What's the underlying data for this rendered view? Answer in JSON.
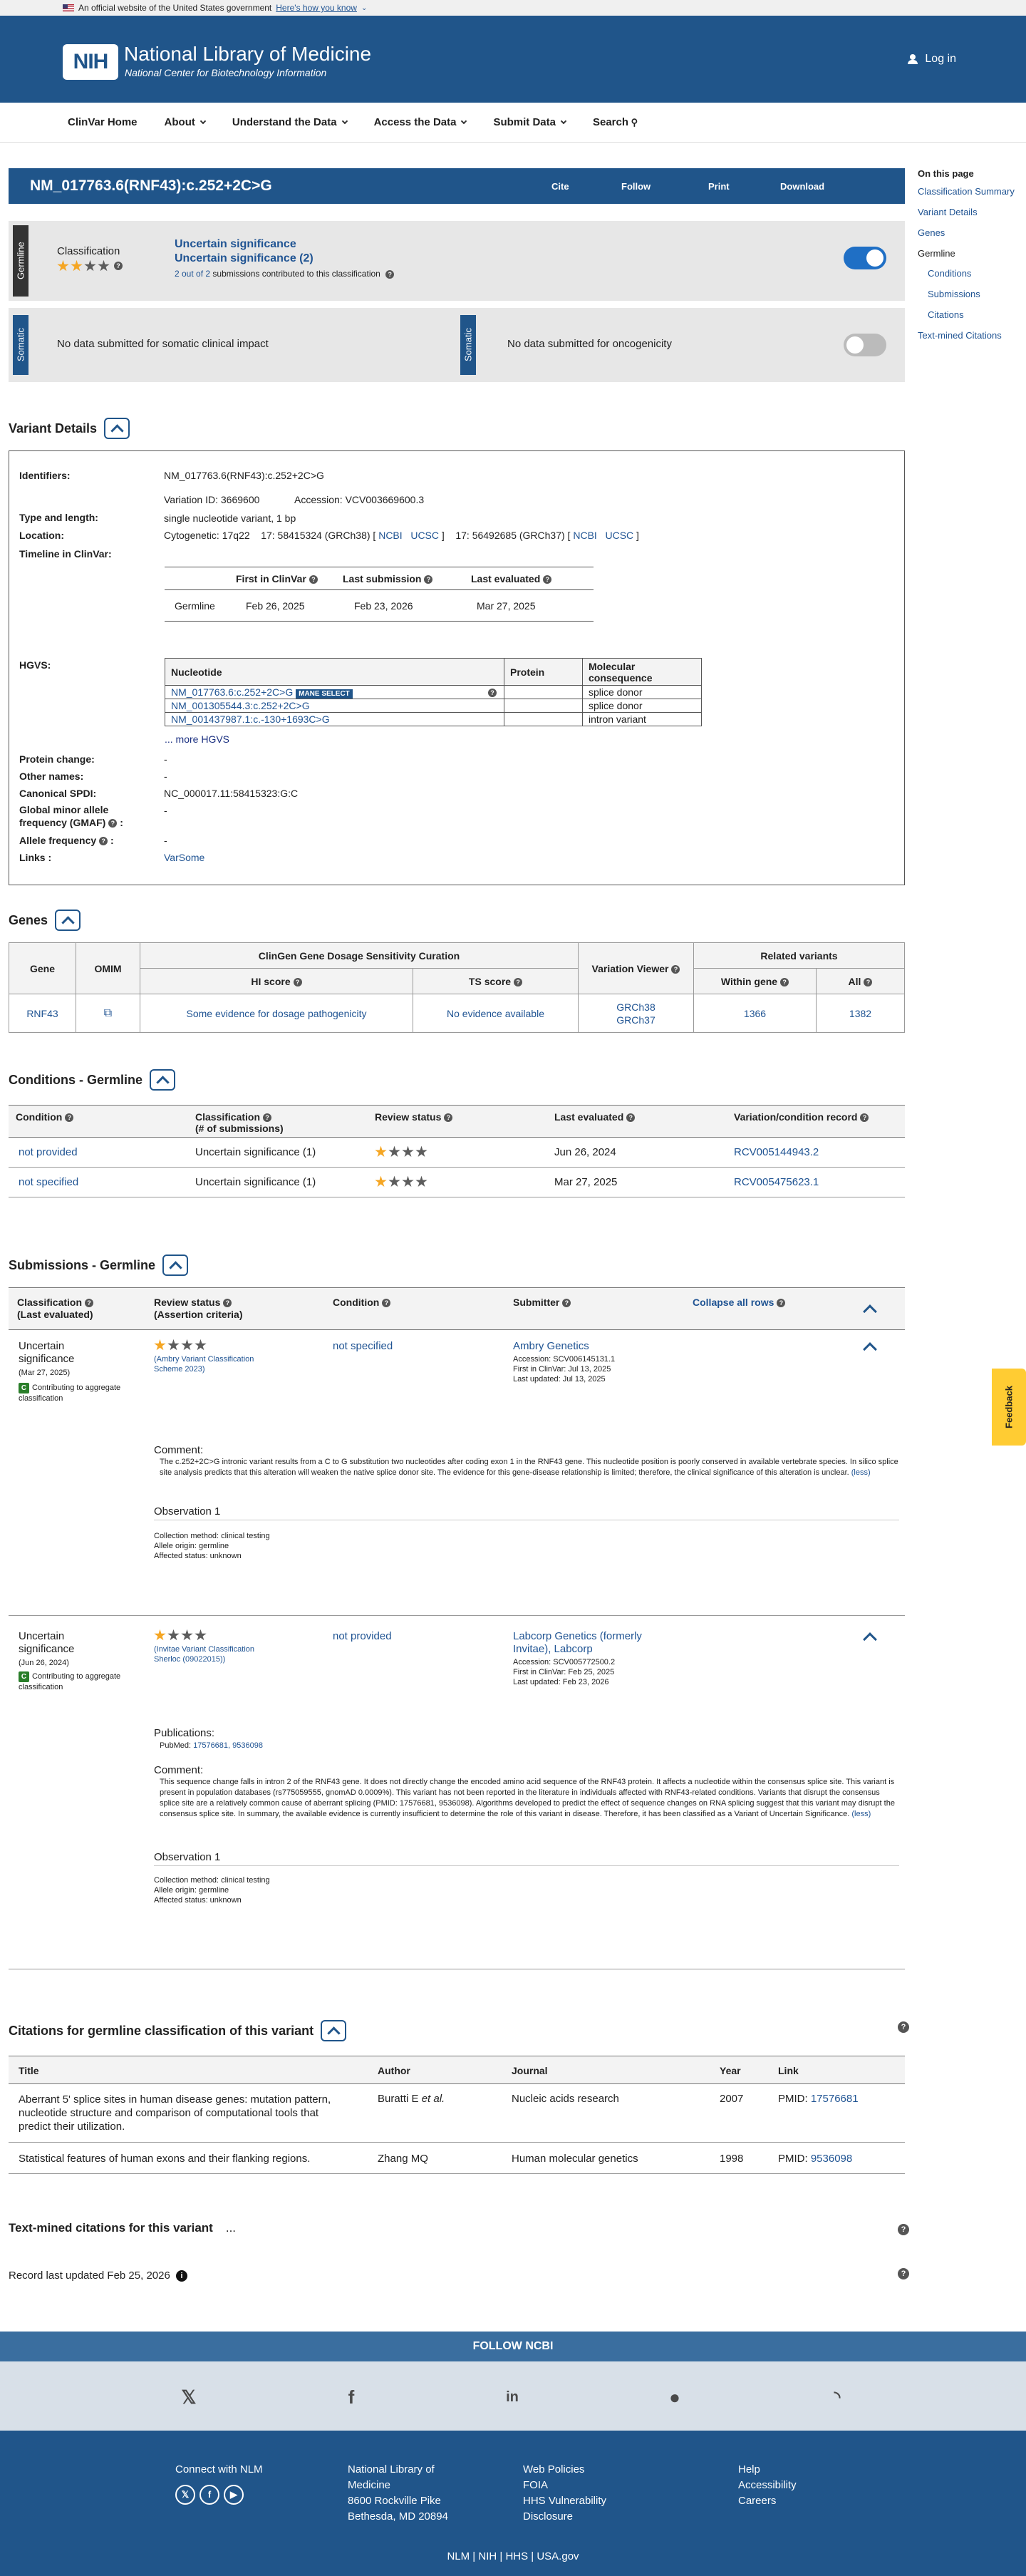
{
  "gov_banner": {
    "text": "An official website of the United States government",
    "link": "Here's how you know"
  },
  "header": {
    "logo": "NIH",
    "title": "National Library of Medicine",
    "subtitle": "National Center for Biotechnology Information",
    "login": "Log in"
  },
  "nav": {
    "items": [
      "ClinVar Home",
      "About",
      "Understand the Data",
      "Access the Data",
      "Submit Data",
      "Search"
    ]
  },
  "title_bar": {
    "title": "NM_017763.6(RNF43):c.252+2C>G",
    "actions": [
      "Cite",
      "Follow",
      "Print",
      "Download"
    ]
  },
  "right_nav": {
    "heading": "On this page",
    "items": [
      "Classification Summary",
      "Variant Details",
      "Genes",
      "Germline",
      "Conditions",
      "Submissions",
      "Citations",
      "Text-mined Citations"
    ]
  },
  "germline": {
    "tab": "Germline",
    "label": "Classification",
    "stars_on": 2,
    "stars_total": 4,
    "sig1": "Uncertain significance",
    "sig2": "Uncertain significance (2)",
    "sub_link": "2 out of 2",
    "sub_text": "submissions contributed to this classification",
    "toggle_color": "#1f6fc5"
  },
  "somatic": {
    "tab": "Somatic",
    "left": "No data submitted for somatic clinical impact",
    "right_tab": "Somatic",
    "right": "No data submitted for oncogenicity"
  },
  "variant_details": {
    "heading": "Variant Details",
    "identifiers_label": "Identifiers:",
    "identifiers": "NM_017763.6(RNF43):c.252+2C>G",
    "variation_id": "Variation ID: 3669600",
    "accession": "Accession: VCV003669600.3",
    "type_label": "Type and length:",
    "type": "single nucleotide variant, 1 bp",
    "location_label": "Location:",
    "cytogenetic": "Cytogenetic: 17q22",
    "grch38": "17: 58415324 (GRCh38) [",
    "grch37": "17: 56492685 (GRCh37) [",
    "ncbi": "NCBI",
    "ucsc": "UCSC",
    "timeline_label": "Timeline in ClinVar:",
    "timeline_headers": [
      "First in ClinVar",
      "Last submission",
      "Last evaluated"
    ],
    "timeline_row": [
      "Germline",
      "Feb 26, 2025",
      "Feb 23, 2026",
      "Mar 27, 2025"
    ],
    "hgvs_label": "HGVS:",
    "hgvs_headers": [
      "Nucleotide",
      "Protein",
      "Molecular consequence"
    ],
    "hgvs_rows": [
      {
        "nuc": "NM_017763.6:c.252+2C>G",
        "badge": "MANE SELECT",
        "prot": "",
        "cons": "splice donor"
      },
      {
        "nuc": "NM_001305544.3:c.252+2C>G",
        "badge": "",
        "prot": "",
        "cons": "splice donor"
      },
      {
        "nuc": "NM_001437987.1:c.-130+1693C>G",
        "badge": "",
        "prot": "",
        "cons": "intron variant"
      }
    ],
    "more_hgvs": "... more HGVS",
    "protein_change_label": "Protein change:",
    "protein_change": "-",
    "other_names_label": "Other names:",
    "other_names": "-",
    "spdi_label": "Canonical SPDI:",
    "spdi": "NC_000017.11:58415323:G:C",
    "gmaf_label1": "Global minor allele",
    "gmaf_label2": "frequency (GMAF)",
    "gmaf": "-",
    "af_label": "Allele frequency",
    "af": "-",
    "links_label": "Links :",
    "links": "VarSome"
  },
  "genes": {
    "heading": "Genes",
    "group_header": "ClinGen Gene Dosage Sensitivity Curation",
    "related_header": "Related variants",
    "headers": [
      "Gene",
      "OMIM",
      "HI score",
      "TS score",
      "Variation Viewer",
      "Within gene",
      "All"
    ],
    "row": {
      "gene": "RNF43",
      "hi": "Some evidence for dosage pathogenicity",
      "ts": "No evidence available",
      "vv1": "GRCh38",
      "vv2": "GRCh37",
      "within": "1366",
      "all": "1382"
    }
  },
  "conditions": {
    "heading": "Conditions - Germline",
    "headers": [
      "Condition",
      "Classification",
      "(# of submissions)",
      "Review status",
      "Last evaluated",
      "Variation/condition record"
    ],
    "rows": [
      {
        "condition": "not provided",
        "classification": "Uncertain significance (1)",
        "stars": 1,
        "evaluated": "Jun 26, 2024",
        "record": "RCV005144943.2"
      },
      {
        "condition": "not specified",
        "classification": "Uncertain significance (1)",
        "stars": 1,
        "evaluated": "Mar 27, 2025",
        "record": "RCV005475623.1"
      }
    ]
  },
  "submissions": {
    "heading": "Submissions - Germline",
    "headers": [
      "Classification",
      "(Last evaluated)",
      "Review status",
      "(Assertion criteria)",
      "Condition",
      "Submitter",
      "Collapse all rows"
    ],
    "rows": [
      {
        "cls1": "Uncertain",
        "cls2": "significance",
        "date": "(Mar 27, 2025)",
        "contrib": "Contributing to aggregate classification",
        "crit1": "(Ambry Variant Classification",
        "crit2": "Scheme 2023)",
        "condition": "not specified",
        "submitter": "Ambry Genetics",
        "submitter2": "",
        "acc": "Accession: SCV006145131.1",
        "first": "First in ClinVar: Jul 13, 2025",
        "updated": "Last updated: Jul 13, 2025",
        "comment_label": "Comment:",
        "comment": "The c.252+2C>G intronic variant results from a C to G substitution two nucleotides after coding exon 1 in the RNF43 gene. This nucleotide position is poorly conserved in available vertebrate species. In silico splice site analysis predicts that this alteration will weaken the native splice donor site. The evidence for this gene-disease relationship is limited; therefore, the clinical significance of this alteration is unclear.",
        "less": "(less)",
        "obs": "Observation 1",
        "method": "Collection method: clinical testing",
        "origin": "Allele origin: germline",
        "affected": "Affected status: unknown"
      },
      {
        "cls1": "Uncertain",
        "cls2": "significance",
        "date": "(Jun 26, 2024)",
        "contrib": "Contributing to aggregate classification",
        "crit1": "(Invitae Variant Classification",
        "crit2": "Sherloc (09022015))",
        "condition": "not provided",
        "submitter": "Labcorp Genetics (formerly",
        "submitter2": "Invitae), Labcorp",
        "acc": "Accession: SCV005772500.2",
        "first": "First in ClinVar: Feb 25, 2025",
        "updated": "Last updated: Feb 23, 2026",
        "pubs_label": "Publications:",
        "pubmed": "PubMed:",
        "pmids": "17576681, 9536098",
        "comment_label": "Comment:",
        "comment": "This sequence change falls in intron 2 of the RNF43 gene. It does not directly change the encoded amino acid sequence of the RNF43 protein. It affects a nucleotide within the consensus splice site. This variant is present in population databases (rs775059555, gnomAD 0.0009%). This variant has not been reported in the literature in individuals affected with RNF43-related conditions. Variants that disrupt the consensus splice site are a relatively common cause of aberrant splicing (PMID: 17576681, 9536098). Algorithms developed to predict the effect of sequence changes on RNA splicing suggest that this variant may disrupt the consensus splice site. In summary, the available evidence is currently insufficient to determine the role of this variant in disease. Therefore, it has been classified as a Variant of Uncertain Significance.",
        "less": "(less)",
        "obs": "Observation 1",
        "method": "Collection method: clinical testing",
        "origin": "Allele origin: germline",
        "affected": "Affected status: unknown"
      }
    ]
  },
  "citations": {
    "heading": "Citations for germline classification of this variant",
    "headers": [
      "Title",
      "Author",
      "Journal",
      "Year",
      "Link"
    ],
    "rows": [
      {
        "title": "Aberrant 5' splice sites in human disease genes: mutation pattern, nucleotide structure and comparison of computational tools that predict their utilization.",
        "author": "Buratti E",
        "etal": " et al.",
        "journal": "Nucleic acids research",
        "year": "2007",
        "pmid_label": "PMID: ",
        "pmid": "17576681"
      },
      {
        "title": "Statistical features of human exons and their flanking regions.",
        "author": "Zhang MQ",
        "etal": "",
        "journal": "Human molecular genetics",
        "year": "1998",
        "pmid_label": "PMID: ",
        "pmid": "9536098"
      }
    ]
  },
  "textmined": {
    "heading": "Text-mined citations for this variant",
    "dots": "..."
  },
  "record_updated": "Record last updated Feb 25, 2026",
  "footer": {
    "follow": "FOLLOW NCBI",
    "connect": "Connect with NLM",
    "address": [
      "National Library of",
      "Medicine",
      "8600 Rockville Pike",
      "Bethesda, MD 20894"
    ],
    "policies": [
      "Web Policies",
      "FOIA",
      "HHS Vulnerability",
      "Disclosure"
    ],
    "help": [
      "Help",
      "Accessibility",
      "Careers"
    ],
    "bottom": [
      "NLM",
      "NIH",
      "HHS",
      "USA.gov"
    ]
  },
  "feedback": "Feedback"
}
